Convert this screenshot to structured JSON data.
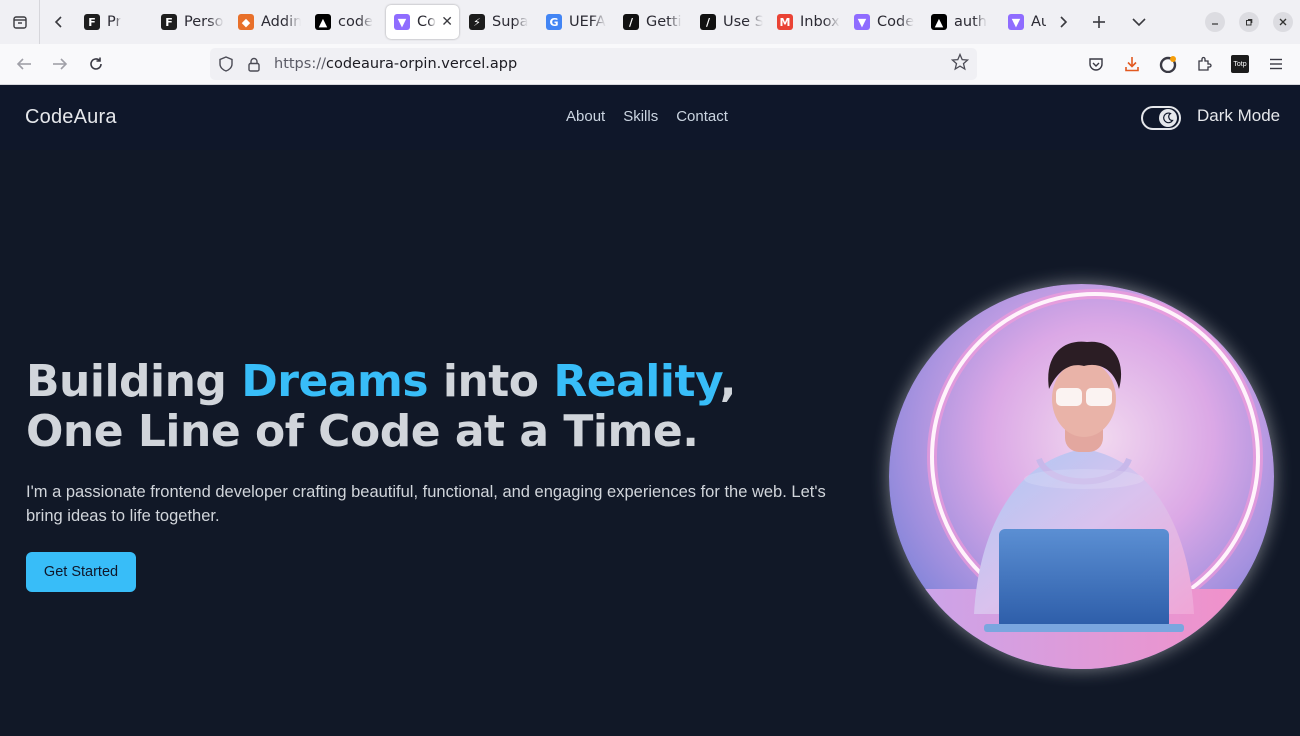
{
  "browser": {
    "tabs": [
      {
        "title": "Pr",
        "icon": "figma-icon",
        "color": "#1e1e1e"
      },
      {
        "title": "Personal",
        "icon": "figma-icon",
        "color": "#1e1e1e"
      },
      {
        "title": "Adding",
        "icon": "gitlab-icon",
        "color": "#e8702a"
      },
      {
        "title": "code",
        "icon": "vercel-icon",
        "color": "#000000"
      },
      {
        "title": "Co",
        "icon": "vite-icon",
        "color": "#8f6cff",
        "active": true
      },
      {
        "title": "Supa",
        "icon": "supabase-icon",
        "color": "#1c1c1c"
      },
      {
        "title": "UEFA",
        "icon": "google-icon",
        "color": "#4285f4"
      },
      {
        "title": "Getti",
        "icon": "shadcn-icon",
        "color": "#111111"
      },
      {
        "title": "Use S",
        "icon": "shadcn-icon",
        "color": "#111111"
      },
      {
        "title": "Inbox",
        "icon": "gmail-icon",
        "color": "#ea4335"
      },
      {
        "title": "Code",
        "icon": "vite-icon",
        "color": "#8f6cff"
      },
      {
        "title": "auth",
        "icon": "vercel-icon",
        "color": "#000000"
      },
      {
        "title": "Auth",
        "icon": "vite-icon",
        "color": "#8f6cff"
      }
    ],
    "url_scheme": "https://",
    "url_host": "codeaura-orpin.vercel.app",
    "extension_label": "Totp"
  },
  "site": {
    "brand": "CodeAura",
    "nav": [
      "About",
      "Skills",
      "Contact"
    ],
    "toggle_label": "Dark Mode",
    "hero": {
      "title_parts": [
        "Building ",
        "Dreams",
        " into ",
        "Reality",
        ", One Line of Code at a Time."
      ],
      "subtitle": "I'm a passionate frontend developer crafting beautiful, functional, and engaging experiences for the web. Let's bring ideas to life together.",
      "cta": "Get Started"
    },
    "colors": {
      "accent": "#38bdf8",
      "background": "#111827",
      "header": "#0f172a"
    }
  }
}
